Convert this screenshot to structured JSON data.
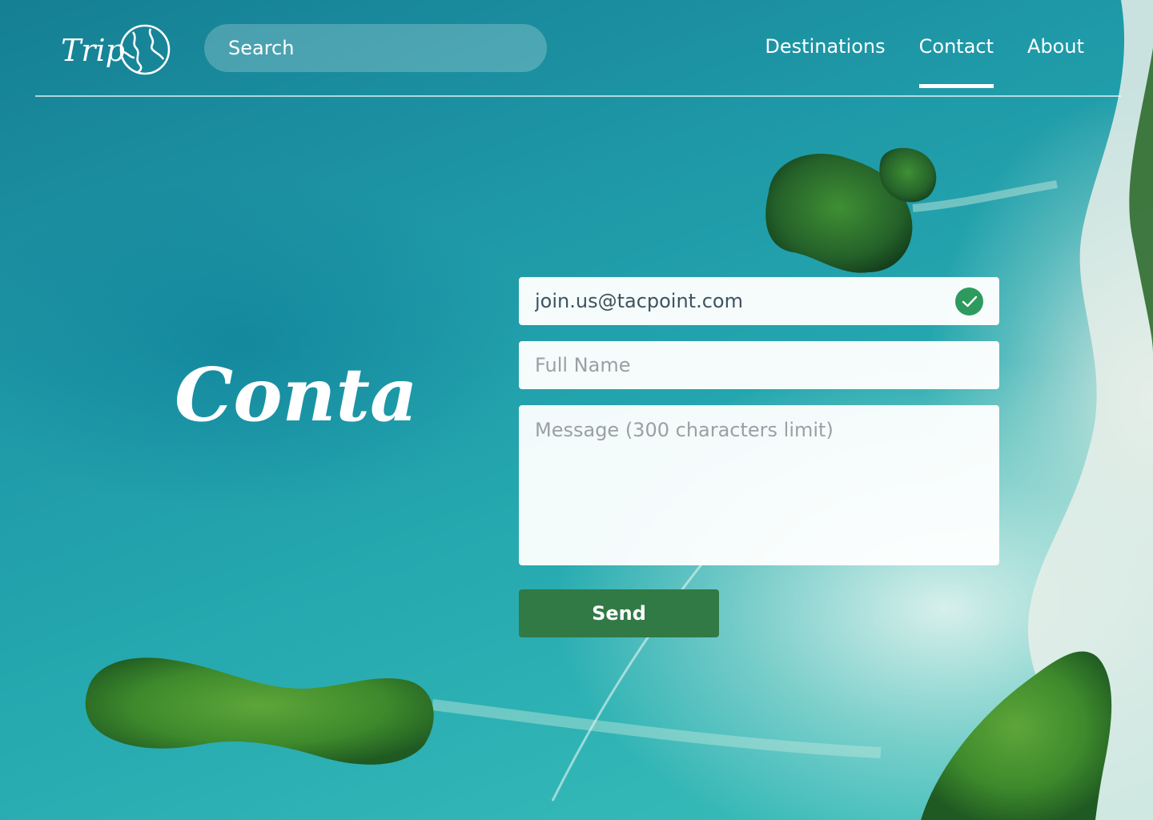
{
  "brand": {
    "logo_text": "Trip"
  },
  "search": {
    "placeholder": "Search"
  },
  "nav": {
    "items": [
      {
        "label": "Destinations",
        "active": false
      },
      {
        "label": "Contact",
        "active": true
      },
      {
        "label": "About",
        "active": false
      }
    ]
  },
  "page": {
    "title": "Contact"
  },
  "form": {
    "email": {
      "value": "join.us@tacpoint.com",
      "valid": true
    },
    "full_name": {
      "placeholder": "Full Name",
      "value": ""
    },
    "message": {
      "placeholder": "Message (300 characters limit)",
      "value": ""
    },
    "send_label": "Send"
  },
  "icons": {
    "logo": "globe-icon",
    "email_status": "checkmark-icon"
  },
  "colors": {
    "primary_button": "#317a45",
    "valid_check": "#2e9a5e",
    "text_on_field": "#3d5360"
  }
}
